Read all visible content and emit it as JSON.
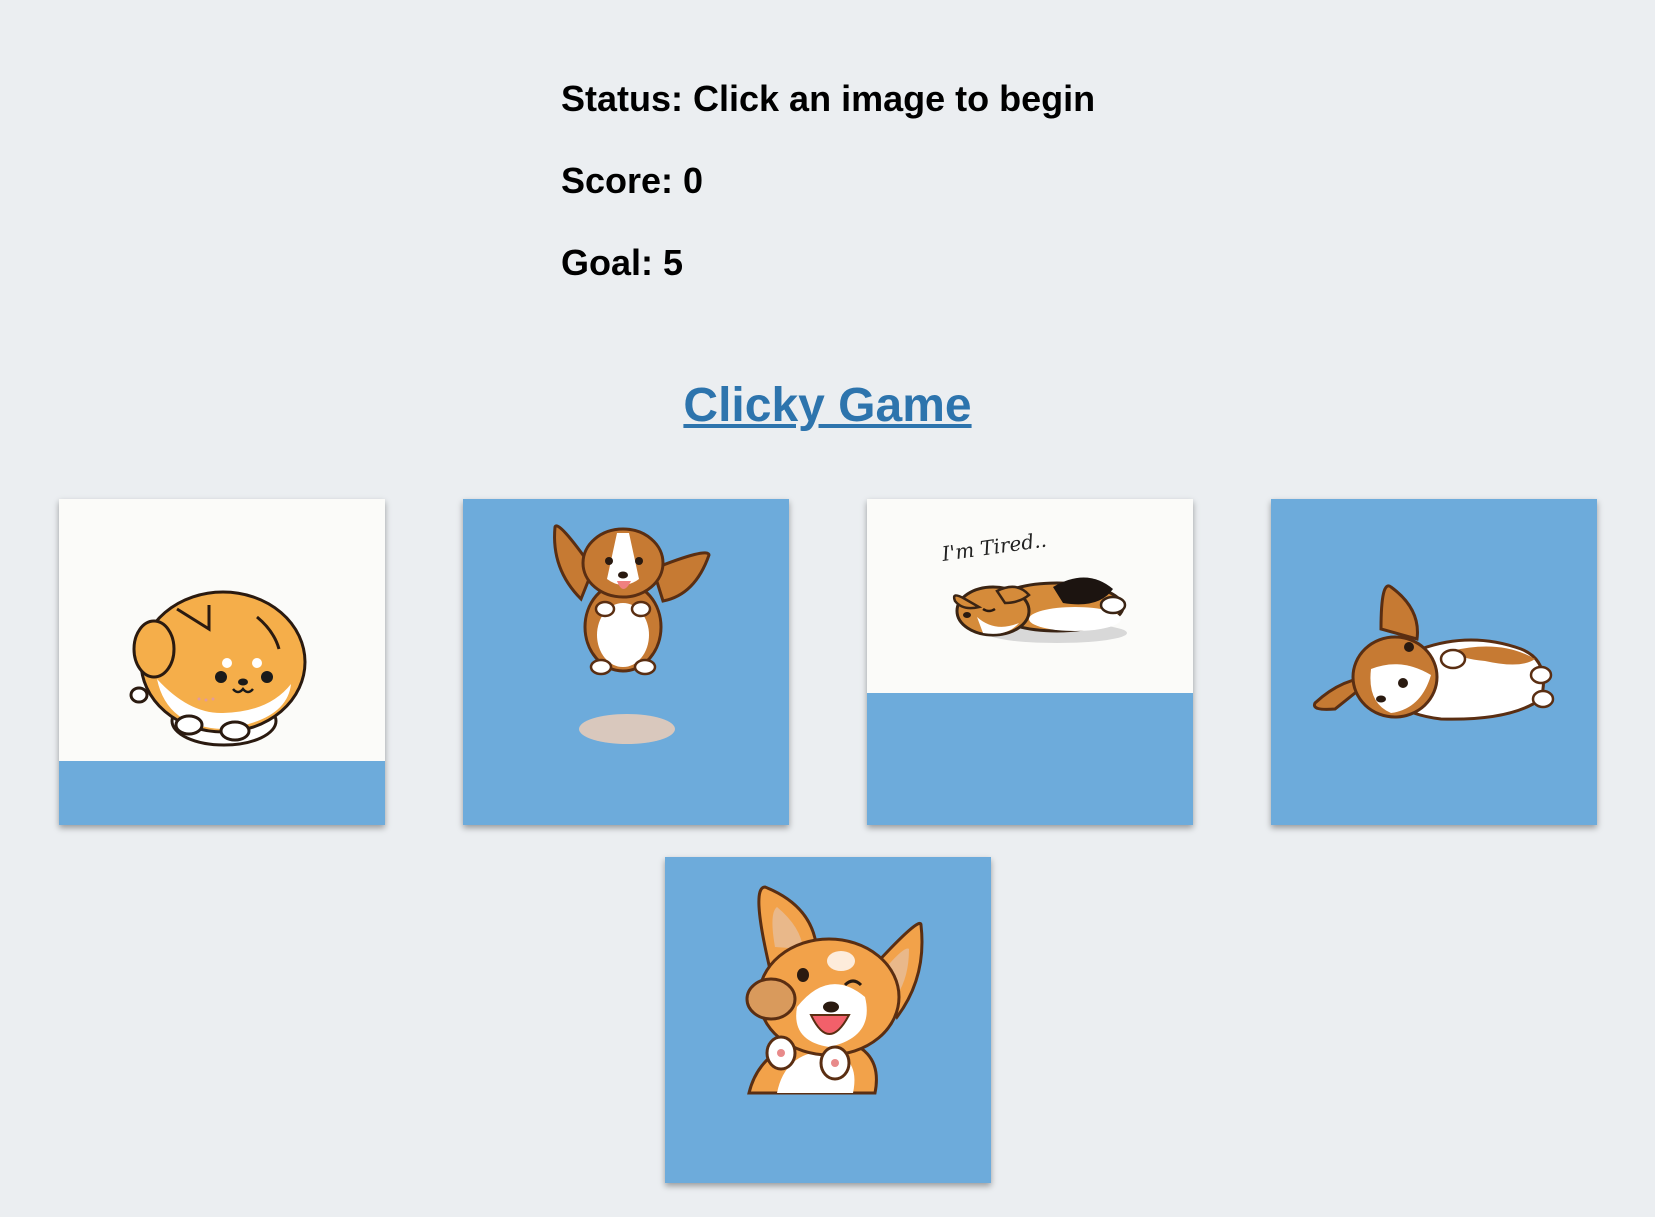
{
  "status": {
    "status_text": "Status: Click an image to begin",
    "score_text": "Score: 0",
    "goal_text": "Goal: 5"
  },
  "game": {
    "title": "Clicky Game"
  },
  "cards": [
    {
      "icon": "round-shiba-puppy-icon"
    },
    {
      "icon": "jumping-corgi-icon"
    },
    {
      "icon": "tired-corgi-icon",
      "caption": "I'm Tired.."
    },
    {
      "icon": "lying-corgi-icon"
    },
    {
      "icon": "waving-corgi-icon"
    }
  ],
  "colors": {
    "background": "#ebeef1",
    "card_blue": "#6dabdb",
    "link": "#2d74ad",
    "dog_orange": "#f5ae4a",
    "corgi_brown": "#c67a33"
  }
}
